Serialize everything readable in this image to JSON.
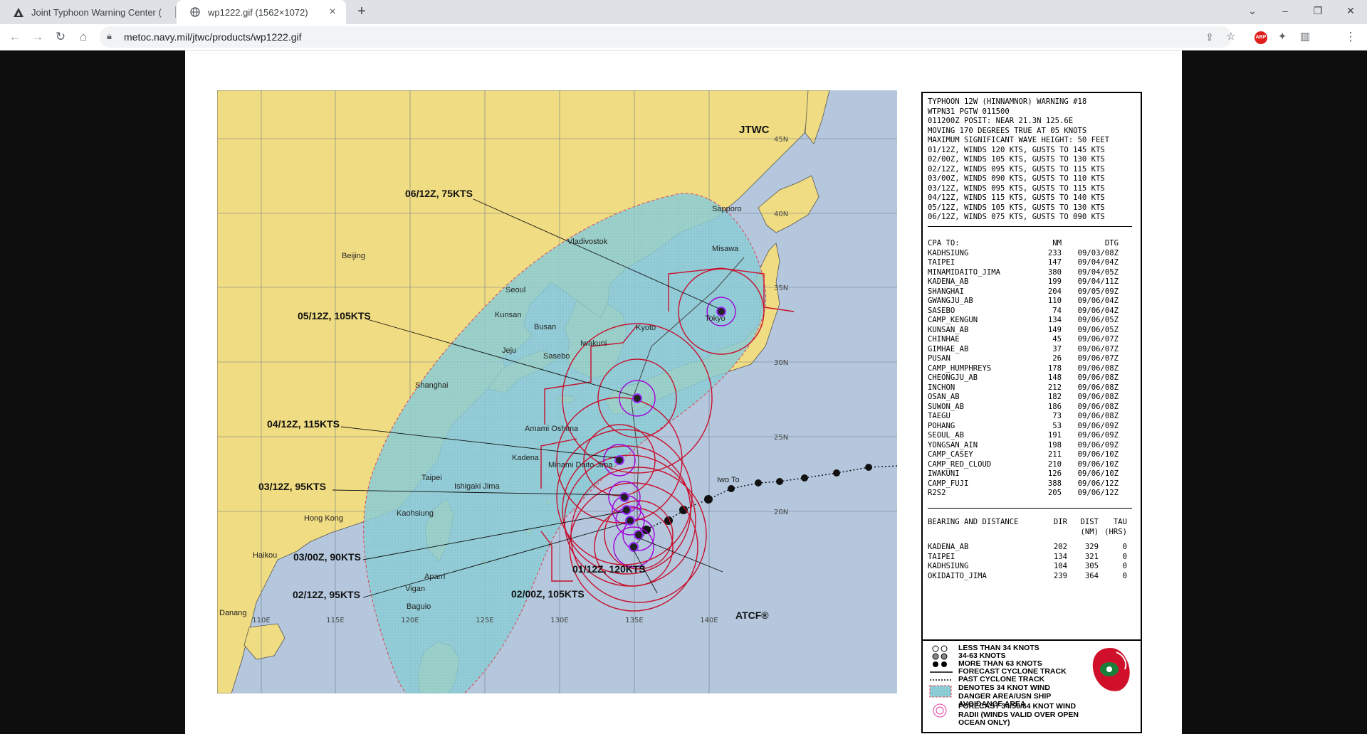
{
  "browser": {
    "tabs": [
      {
        "title": "Joint Typhoon Warning Center (",
        "icon": "jtwc-triangle-icon"
      },
      {
        "title": "wp1222.gif (1562×1072)",
        "icon": "globe-icon"
      }
    ],
    "url": "metoc.navy.mil/jtwc/products/wp1222.gif",
    "extension_badge": "ABP"
  },
  "map": {
    "agency_label": "JTWC",
    "atcf_label": "ATCF®",
    "lat_labels": [
      "45N",
      "40N",
      "35N",
      "30N",
      "25N",
      "20N"
    ],
    "lon_labels": [
      "110E",
      "115E",
      "120E",
      "125E",
      "130E",
      "135E",
      "140E"
    ],
    "cities": [
      "Vladivostok",
      "Sapporo",
      "Misawa",
      "Beijing",
      "Seoul",
      "Kunsan",
      "Busan",
      "Iwakuni",
      "Kyoto",
      "Tokyo",
      "Jeju",
      "Sasebo",
      "Shanghai",
      "Amami Oshima",
      "Kadena",
      "Minami Daito Jima",
      "Taipei",
      "Ishigaki Jima",
      "Kaohsiung",
      "Hong Kong",
      "Iwo To",
      "Haikou",
      "Aparri",
      "Vigan",
      "Baguio",
      "Danang"
    ],
    "forecast_labels": [
      "06/12Z,  75KTS",
      "05/12Z, 105KTS",
      "04/12Z, 115KTS",
      "03/12Z,  95KTS",
      "03/00Z,  90KTS",
      "02/12Z,  95KTS",
      "01/12Z, 120KTS",
      "02/00Z, 105KTS"
    ],
    "colors": {
      "land": "#f0dc82",
      "ocean": "#b4c7dc",
      "danger": "#8fd1d8",
      "wind34": "#c8102e",
      "wind64": "#a100d8"
    }
  },
  "warning": {
    "header_lines": [
      "TYPHOON 12W (HINNAMNOR) WARNING #18",
      "WTPN31 PGTW 011500",
      "011200Z POSIT: NEAR 21.3N 125.6E",
      "MOVING 170 DEGREES TRUE AT 05 KNOTS",
      "MAXIMUM SIGNIFICANT WAVE HEIGHT: 50 FEET",
      "01/12Z, WINDS 120 KTS, GUSTS TO 145 KTS",
      "02/00Z, WINDS 105 KTS, GUSTS TO 130 KTS",
      "02/12Z, WINDS 095 KTS, GUSTS TO 115 KTS",
      "03/00Z, WINDS 090 KTS, GUSTS TO 110 KTS",
      "03/12Z, WINDS 095 KTS, GUSTS TO 115 KTS",
      "04/12Z, WINDS 115 KTS, GUSTS TO 140 KTS",
      "05/12Z, WINDS 105 KTS, GUSTS TO 130 KTS",
      "06/12Z, WINDS 075 KTS, GUSTS TO 090 KTS"
    ],
    "cpa_header": [
      "CPA TO:",
      "NM",
      "DTG"
    ],
    "cpa_rows": [
      [
        "KADHSIUNG",
        "233",
        "09/03/08Z"
      ],
      [
        "TAIPEI",
        "147",
        "09/04/04Z"
      ],
      [
        "MINAMIDAITO_JIMA",
        "380",
        "09/04/05Z"
      ],
      [
        "KADENA_AB",
        "199",
        "09/04/11Z"
      ],
      [
        "SHANGHAI",
        "204",
        "09/05/09Z"
      ],
      [
        "GWANGJU_AB",
        "110",
        "09/06/04Z"
      ],
      [
        "SASEBO",
        "74",
        "09/06/04Z"
      ],
      [
        "CAMP_KENGUN",
        "134",
        "09/06/05Z"
      ],
      [
        "KUNSAN_AB",
        "149",
        "09/06/05Z"
      ],
      [
        "CHINHAE",
        "45",
        "09/06/07Z"
      ],
      [
        "GIMHAE_AB",
        "37",
        "09/06/07Z"
      ],
      [
        "PUSAN",
        "26",
        "09/06/07Z"
      ],
      [
        "CAMP_HUMPHREYS",
        "178",
        "09/06/08Z"
      ],
      [
        "CHEONGJU_AB",
        "148",
        "09/06/08Z"
      ],
      [
        "INCHON",
        "212",
        "09/06/08Z"
      ],
      [
        "OSAN_AB",
        "182",
        "09/06/08Z"
      ],
      [
        "SUWON_AB",
        "186",
        "09/06/08Z"
      ],
      [
        "TAEGU",
        "73",
        "09/06/08Z"
      ],
      [
        "POHANG",
        "53",
        "09/06/09Z"
      ],
      [
        "SEOUL_AB",
        "191",
        "09/06/09Z"
      ],
      [
        "YONGSAN_AIN",
        "198",
        "09/06/09Z"
      ],
      [
        "CAMP_CASEY",
        "211",
        "09/06/10Z"
      ],
      [
        "CAMP_RED_CLOUD",
        "210",
        "09/06/10Z"
      ],
      [
        "IWAKUNI",
        "126",
        "09/06/10Z"
      ],
      [
        "CAMP_FUJI",
        "388",
        "09/06/12Z"
      ],
      [
        "R2S2",
        "205",
        "09/06/12Z"
      ]
    ],
    "bd_header": [
      "BEARING AND DISTANCE",
      "DIR",
      "DIST",
      "TAU"
    ],
    "bd_subheader": [
      "(NM)",
      "(HRS)"
    ],
    "bd_rows": [
      [
        "KADENA_AB",
        "202",
        "329",
        "0"
      ],
      [
        "TAIPEI",
        "134",
        "321",
        "0"
      ],
      [
        "KADHSIUNG",
        "104",
        "305",
        "0"
      ],
      [
        "OKIDAITO_JIMA",
        "239",
        "364",
        "0"
      ]
    ]
  },
  "legend": {
    "items": [
      "LESS THAN 34 KNOTS",
      "34-63 KNOTS",
      "MORE THAN 63 KNOTS",
      "FORECAST CYCLONE TRACK",
      "PAST CYCLONE TRACK",
      "DENOTES 34 KNOT WIND DANGER AREA/USN SHIP AVOIDANCE AREA",
      "FORECAST 34/50/64 KNOT WIND RADII (WINDS VALID OVER OPEN OCEAN ONLY)"
    ]
  }
}
